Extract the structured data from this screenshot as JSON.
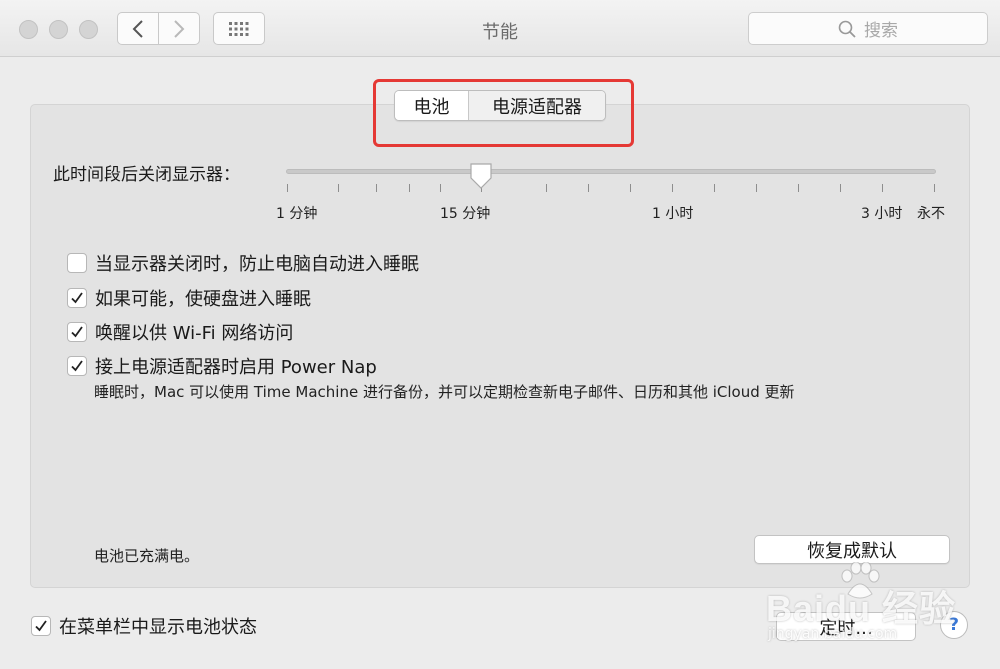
{
  "window": {
    "title": "节能"
  },
  "search": {
    "placeholder": "搜索",
    "icon": "search-icon"
  },
  "tabs": [
    {
      "label": "电池",
      "selected": true
    },
    {
      "label": "电源适配器",
      "selected": false
    }
  ],
  "slider": {
    "label": "此时间段后关闭显示器：",
    "value": "15 分钟",
    "tick_labels": [
      "1 分钟",
      "15 分钟",
      "1 小时",
      "3 小时",
      "永不"
    ]
  },
  "options": [
    {
      "label": "当显示器关闭时，防止电脑自动进入睡眠",
      "checked": false
    },
    {
      "label": "如果可能，使硬盘进入睡眠",
      "checked": true
    },
    {
      "label": "唤醒以供 Wi-Fi 网络访问",
      "checked": true
    },
    {
      "label": "接上电源适配器时启用 Power Nap",
      "checked": true
    }
  ],
  "power_nap_description": "睡眠时，Mac 可以使用 Time Machine 进行备份，并可以定期检查新电子邮件、日历和其他 iCloud 更新",
  "battery_status": "电池已充满电。",
  "restore_button": "恢复成默认",
  "menu_bar_option": {
    "label": "在菜单栏中显示电池状态",
    "checked": true
  },
  "schedule_button": "定时...",
  "help_button": "?",
  "watermark": {
    "main": "Baidu 经验",
    "sub": "jingyan.baidu.com"
  },
  "colors": {
    "highlight": "#e53935",
    "help": "#3a78d6"
  }
}
